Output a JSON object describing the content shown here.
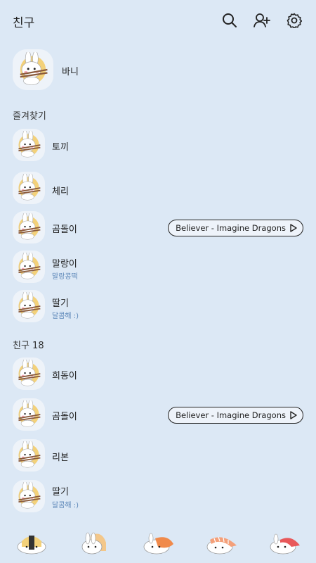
{
  "header": {
    "title": "친구",
    "icons": [
      "search-icon",
      "add-friend-icon",
      "settings-icon"
    ]
  },
  "profile": {
    "name": "바니"
  },
  "favorites": {
    "label": "즐겨찾기",
    "items": [
      {
        "name": "토끼",
        "status": ""
      },
      {
        "name": "체리",
        "status": ""
      },
      {
        "name": "곰돌이",
        "status": "",
        "music": "Believer - Imagine Dragons"
      },
      {
        "name": "말랑이",
        "status": "말랑콩떡"
      },
      {
        "name": "딸기",
        "status": "달콤해 :)"
      }
    ]
  },
  "friends": {
    "label": "친구 18",
    "items": [
      {
        "name": "희동이",
        "status": ""
      },
      {
        "name": "곰돌이",
        "status": "",
        "music": "Believer - Imagine Dragons"
      },
      {
        "name": "리본",
        "status": ""
      },
      {
        "name": "딸기",
        "status": "달콤해 :)"
      }
    ]
  },
  "tabs": [
    "friends-tab",
    "chats-tab",
    "view-tab",
    "shopping-tab",
    "more-tab"
  ],
  "colors": {
    "background": "#dce8f5",
    "accent": "#f2c94c",
    "status": "#5b86b8"
  }
}
